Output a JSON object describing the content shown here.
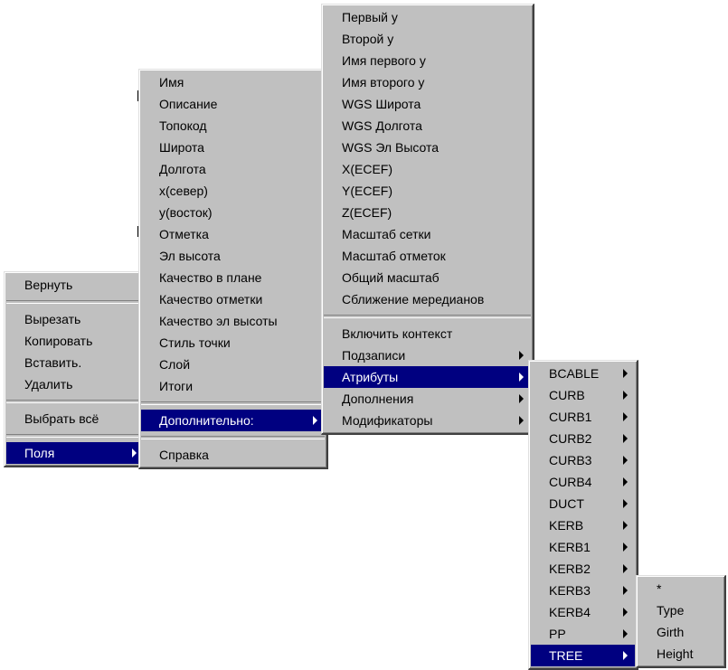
{
  "menu1": {
    "undo": "Вернуть",
    "cut": "Вырезать",
    "copy": "Копировать",
    "paste": "Вставить.",
    "delete": "Удалить",
    "select_all": "Выбрать всё",
    "fields": "Поля"
  },
  "menu2": {
    "items": [
      "Имя",
      "Описание",
      "Топокод",
      "Широта",
      "Долгота",
      "x(север)",
      "y(восток)",
      "Отметка",
      "Эл высота",
      "Качество в плане",
      "Качество отметки",
      "Качество эл высоты",
      "Стиль точки",
      "Слой",
      "Итоги"
    ],
    "additional": "Дополнительно:",
    "help": "Справка"
  },
  "menu3": {
    "items": [
      "Первый у",
      "Второй у",
      "Имя первого у",
      "Имя второго у",
      "WGS Широта",
      "WGS Долгота",
      "WGS Эл Высота",
      "X(ECEF)",
      "Y(ECEF)",
      "Z(ECEF)",
      "Масштаб сетки",
      "Масштаб отметок",
      "Общий масштаб",
      "Сближение мередианов"
    ],
    "include_context": "Включить контекст",
    "subrecords": "Подзаписи",
    "attributes": "Атрибуты",
    "additions": "Дополнения",
    "modifiers": "Модификаторы"
  },
  "menu4": {
    "items": [
      "BCABLE",
      "CURB",
      "CURB1",
      "CURB2",
      "CURB3",
      "CURB4",
      "DUCT",
      "KERB",
      "KERB1",
      "KERB2",
      "KERB3",
      "KERB4",
      "PP",
      "TREE"
    ]
  },
  "menu5": {
    "items": [
      "*",
      "Type",
      "Girth",
      "Height"
    ]
  }
}
